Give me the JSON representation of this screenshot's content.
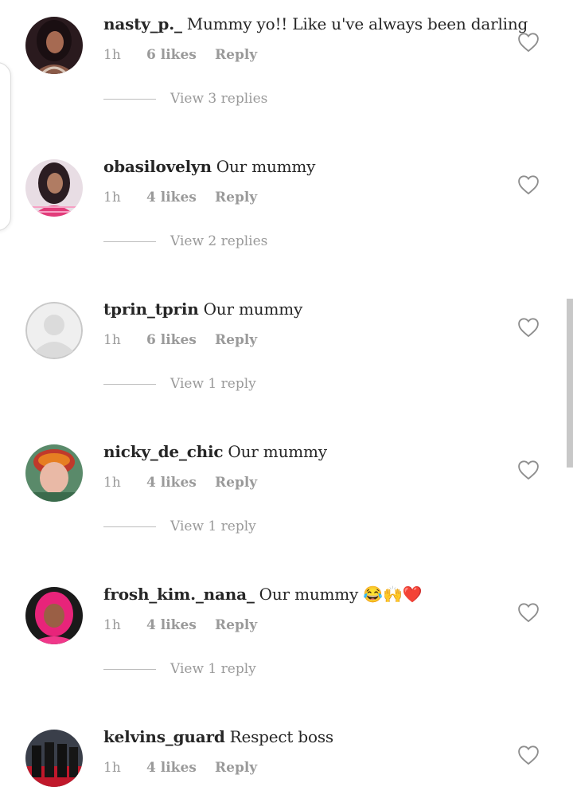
{
  "colors": {
    "text": "#262626",
    "secondary": "#9a9a9a",
    "background": "#ffffff"
  },
  "comments": [
    {
      "username": "nasty_p._",
      "text": "Mummy yo!! Like u've always been darling",
      "time": "1h",
      "likes": "6 likes",
      "reply": "Reply",
      "view_replies": "View 3 replies",
      "avatar_icon": "profile-photo"
    },
    {
      "username": "obasilovelyn",
      "text": "Our mummy",
      "time": "1h",
      "likes": "4 likes",
      "reply": "Reply",
      "view_replies": "View 2 replies",
      "avatar_icon": "profile-photo"
    },
    {
      "username": "tprin_tprin",
      "text": "Our mummy",
      "time": "1h",
      "likes": "6 likes",
      "reply": "Reply",
      "view_replies": "View 1 reply",
      "avatar_icon": "default-avatar"
    },
    {
      "username": "nicky_de_chic",
      "text": "Our mummy",
      "time": "1h",
      "likes": "4 likes",
      "reply": "Reply",
      "view_replies": "View 1 reply",
      "avatar_icon": "profile-photo"
    },
    {
      "username": "frosh_kim._nana_",
      "text": "Our mummy 😂🙌❤️",
      "time": "1h",
      "likes": "4 likes",
      "reply": "Reply",
      "view_replies": "View 1 reply",
      "avatar_icon": "profile-photo"
    },
    {
      "username": "kelvins_guard",
      "text": "Respect boss",
      "time": "1h",
      "likes": "4 likes",
      "reply": "Reply",
      "view_replies": "",
      "avatar_icon": "profile-photo"
    }
  ]
}
